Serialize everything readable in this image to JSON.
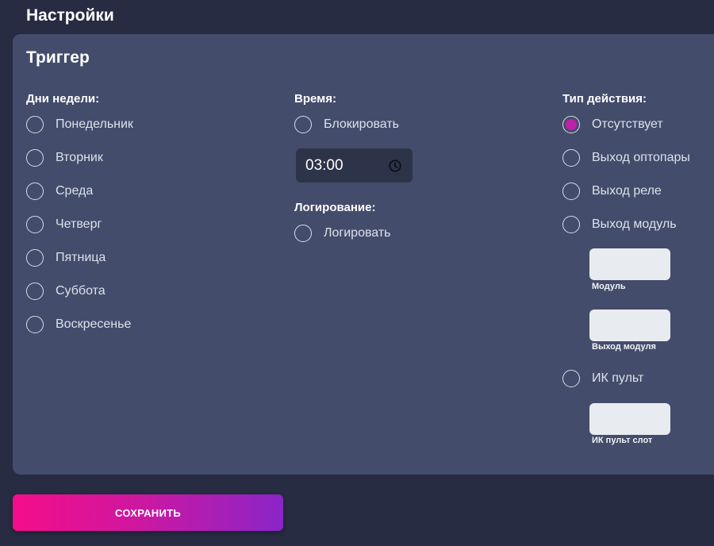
{
  "header": {
    "title": "Настройки"
  },
  "trigger": {
    "title": "Триггер",
    "days": {
      "label": "Дни недели:",
      "items": [
        {
          "label": "Понедельник",
          "selected": false
        },
        {
          "label": "Вторник",
          "selected": false
        },
        {
          "label": "Среда",
          "selected": false
        },
        {
          "label": "Четверг",
          "selected": false
        },
        {
          "label": "Пятница",
          "selected": false
        },
        {
          "label": "Суббота",
          "selected": false
        },
        {
          "label": "Воскресенье",
          "selected": false
        }
      ]
    },
    "time": {
      "label": "Время:",
      "block_label": "Блокировать",
      "block_selected": false,
      "value": "03:00",
      "icon": "clock-icon"
    },
    "logging": {
      "label": "Логирование:",
      "option_label": "Логировать",
      "selected": false
    },
    "action": {
      "label": "Тип действия:",
      "options": [
        {
          "label": "Отсутствует",
          "selected": true
        },
        {
          "label": "Выход оптопары",
          "selected": false
        },
        {
          "label": "Выход реле",
          "selected": false
        },
        {
          "label": "Выход модуль",
          "selected": false
        },
        {
          "label": "ИК пульт",
          "selected": false
        }
      ],
      "module_field": {
        "caption": "Модуль",
        "value": ""
      },
      "module_output_field": {
        "caption": "Выход модуля",
        "value": ""
      },
      "ir_slot_field": {
        "caption": "ИК пульт слот",
        "value": ""
      }
    }
  },
  "footer": {
    "save_label": "СОХРАНИТЬ"
  },
  "colors": {
    "page_bg": "#272c43",
    "card_bg": "#434c6b",
    "radio_selected": "#c020a8",
    "button_gradient_start": "#f50d8a",
    "button_gradient_end": "#8a25c8"
  }
}
